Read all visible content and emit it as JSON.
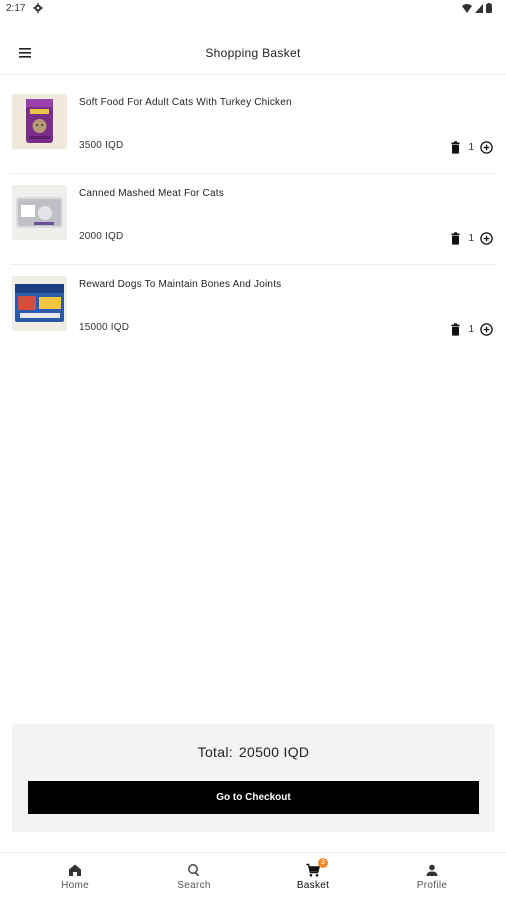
{
  "status_bar": {
    "time": "2:17"
  },
  "app_bar": {
    "title": "Shopping Basket"
  },
  "items": [
    {
      "name": "Soft Food For Adult Cats With Turkey Chicken",
      "price": "3500 IQD",
      "qty": "1"
    },
    {
      "name": "Canned Mashed Meat For Cats",
      "price": "2000 IQD",
      "qty": "1"
    },
    {
      "name": "Reward Dogs To Maintain Bones And Joints",
      "price": "15000 IQD",
      "qty": "1"
    }
  ],
  "summary": {
    "total_label": "Total:",
    "total_value": "20500 IQD",
    "checkout_label": "Go to Checkout"
  },
  "bottom_nav": {
    "home": "Home",
    "search": "Search",
    "basket": "Basket",
    "basket_badge": "3",
    "profile": "Profile"
  },
  "colors": {
    "badge": "#ef8a2b",
    "checkout_bg": "#000000",
    "panel_bg": "#f3f3f3"
  }
}
